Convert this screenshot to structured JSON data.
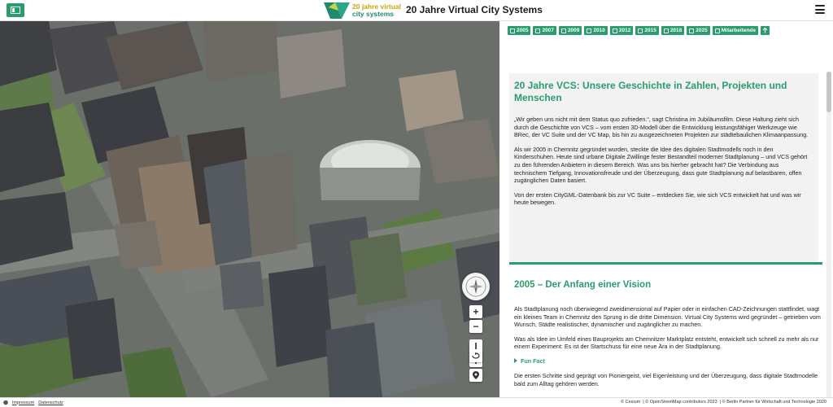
{
  "header": {
    "logo_line1": "20 jahre virtual",
    "logo_line2": "city systems",
    "title": "20 Jahre Virtual City Systems",
    "left_button_icon": "sidebar-toggle-icon",
    "menu_icon": "hamburger-menu-icon"
  },
  "tabs": [
    {
      "label": "2005",
      "icon": "heart-icon"
    },
    {
      "label": "2007",
      "icon": "rocket-icon"
    },
    {
      "label": "2009",
      "icon": "building-icon"
    },
    {
      "label": "2010",
      "icon": "calendar-icon"
    },
    {
      "label": "2012",
      "icon": "book-icon"
    },
    {
      "label": "2015",
      "icon": "eye-icon"
    },
    {
      "label": "2018",
      "icon": "chart-icon"
    },
    {
      "label": "2025",
      "icon": "city-icon"
    },
    {
      "label": "Mitarbeitende",
      "icon": "users-icon"
    }
  ],
  "intro": {
    "title": "20 Jahre VCS: Unsere Geschichte in Zahlen, Projekten und Menschen",
    "p1": "„Wir geben uns nicht mit dem Status quo zufrieden.“, sagt Christina im Jubiläumsfilm. Diese Haltung zieht sich durch die Geschichte von VCS – vom ersten 3D-Modell über die Entwicklung leistungsfähiger Werkzeuge wie BRec, der VC Suite und der VC Map, bis hin zu ausgezeichneten Projekten zur städtebaulichen Klimaanpassung.",
    "p2": "Als wir 2005 in Chemnitz gegründet wurden, steckte die Idee des digitalen Stadtmodells noch in den Kinderschuhen. Heute sind urbane Digitale Zwillinge fester Bestandteil moderner Stadtplanung – und VCS gehört zu den führenden Anbietern in diesem Bereich. Was uns bis hierher gebracht hat? Die Verbindung aus technischem Tiefgang, Innovationsfreude und der Überzeugung, dass gute Stadtplanung auf belastbaren, offen zugänglichen Daten basiert.",
    "p3": "Von der ersten CityGML-Datenbank bis zur VC Suite – entdecken Sie, wie sich VCS entwickelt hat und was wir heute bewegen."
  },
  "section": {
    "title": "2005 – Der Anfang einer Vision",
    "p1": "Als Stadtplanung noch überwiegend zweidimensional auf Papier oder in einfachen CAD-Zeichnungen stattfindet, wagt ein kleines Team in Chemnitz den Sprung in die dritte Dimension. Virtual City Systems wird gegründet – getrieben vom Wunsch, Städte realistischer, dynamischer und zugänglicher zu machen.",
    "p2": "Was als Idee im Umfeld eines Bauprojekts am Chemnitzer Marktplatz entsteht, entwickelt sich schnell zu mehr als nur einem Experiment: Es ist der Startschuss für eine neue Ära in der Stadtplanung.",
    "funfact": "Fun Fact",
    "p3": "Die ersten Schritte sind geprägt von Pioniergeist, viel Eigenleistung und der Überzeugung, dass digitale Stadtmodelle bald zum Alltag gehören werden."
  },
  "map_controls": {
    "zoom_in": "+",
    "zoom_out": "−"
  },
  "footer": {
    "impressum": "Impressum",
    "datenschutz": "Datenschutz",
    "attr1": "© Cesium",
    "attr2": "| © OpenStreetMap contributors 2023",
    "attr3": "| © Berlin Partner für Wirtschaft und Technologie 2020"
  },
  "colors": {
    "accent": "#2a9d6c",
    "intro_bg": "#f2f2f2"
  }
}
